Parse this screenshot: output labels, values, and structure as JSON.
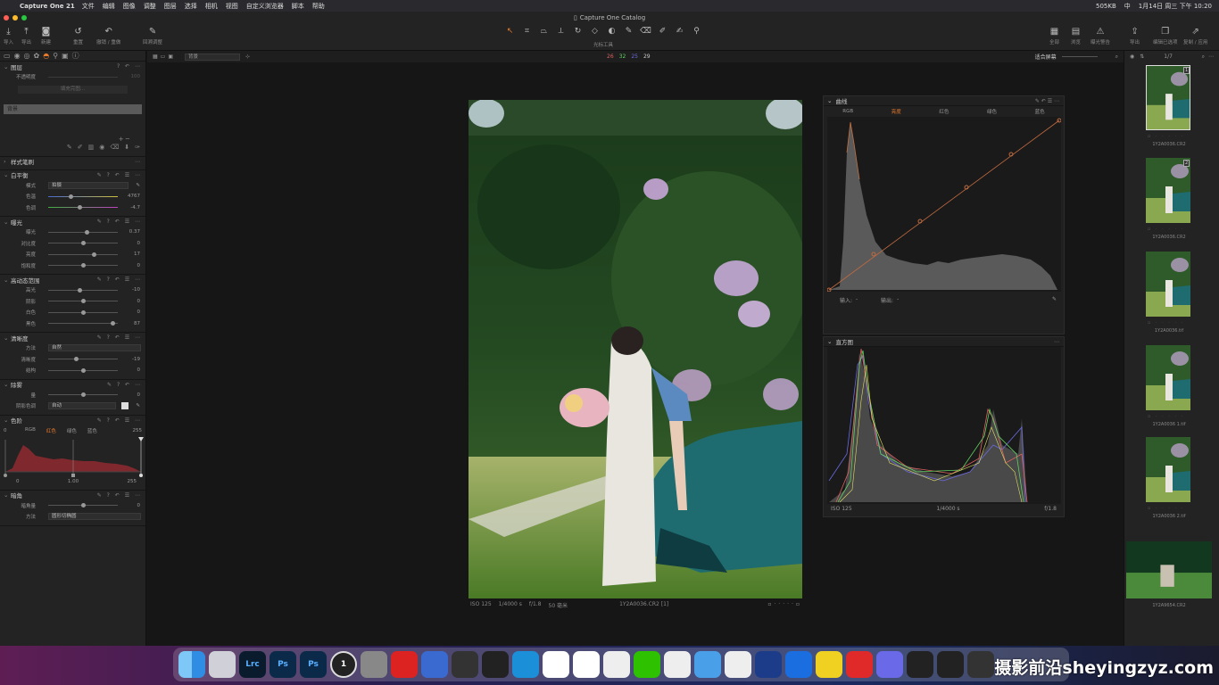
{
  "menubar": {
    "app_name": "Capture One 21",
    "items": [
      "文件",
      "编辑",
      "图像",
      "调整",
      "图层",
      "选择",
      "相机",
      "视图",
      "自定义浏览器",
      "脚本",
      "帮助"
    ],
    "status": [
      "505KB",
      "中",
      "1月14日 周三 下午 10:20"
    ]
  },
  "window": {
    "title": "Capture One Catalog"
  },
  "toolbar": {
    "left_buttons": [
      {
        "label": "导入",
        "icon": "import-icon"
      },
      {
        "label": "导出",
        "icon": "export-icon"
      },
      {
        "label": "新建",
        "icon": "camera-icon"
      },
      {
        "label": "重置",
        "icon": "reset-icon"
      },
      {
        "label": "撤销 / 重做",
        "icon": "undo-icon"
      },
      {
        "label": "回溯调整",
        "icon": "brush-icon"
      }
    ],
    "cursor_tools_label": "光标工具",
    "right_buttons": [
      {
        "label": "全部",
        "icon": "grid-icon"
      },
      {
        "label": "浏览",
        "icon": "browser-icon"
      },
      {
        "label": "曝光警告",
        "icon": "warning-icon"
      },
      {
        "label": "导出",
        "icon": "share-icon"
      },
      {
        "label": "编辑已选项",
        "icon": "edit-selected-icon"
      },
      {
        "label": "复制 / 应用",
        "icon": "copy-apply-icon"
      }
    ]
  },
  "viewer": {
    "layer_select": "背景",
    "readout": [
      "26",
      "32",
      "25",
      "29"
    ],
    "fit_label": "适合屏幕",
    "counter": "1/7"
  },
  "left_panel": {
    "layers": {
      "title": "图层",
      "opacity_label": "不透明度",
      "opacity_value": "100",
      "fill_button": "填充完图...",
      "background_layer": "背景"
    },
    "styles_title": "样式笔刷",
    "white_balance": {
      "title": "白平衡",
      "mode_label": "模式",
      "mode_value": "拍摄",
      "rows": [
        {
          "label": "色温",
          "value": "4767",
          "pos": 0.32
        },
        {
          "label": "色调",
          "value": "-4.7",
          "pos": 0.45
        }
      ]
    },
    "exposure": {
      "title": "曝光",
      "rows": [
        {
          "label": "曝光",
          "value": "0.37",
          "pos": 0.55
        },
        {
          "label": "对比度",
          "value": "0",
          "pos": 0.5
        },
        {
          "label": "亮度",
          "value": "17",
          "pos": 0.65
        },
        {
          "label": "饱和度",
          "value": "0",
          "pos": 0.5
        }
      ]
    },
    "hdr": {
      "title": "高动态范围",
      "rows": [
        {
          "label": "高光",
          "value": "-10",
          "pos": 0.45
        },
        {
          "label": "阴影",
          "value": "0",
          "pos": 0.5
        },
        {
          "label": "白色",
          "value": "0",
          "pos": 0.5
        },
        {
          "label": "黑色",
          "value": "87",
          "pos": 0.92
        }
      ]
    },
    "clarity": {
      "title": "清晰度",
      "method_label": "方法",
      "method_value": "自然",
      "rows": [
        {
          "label": "清晰度",
          "value": "-19",
          "pos": 0.4
        },
        {
          "label": "结构",
          "value": "0",
          "pos": 0.5
        }
      ]
    },
    "dehaze": {
      "title": "除雾",
      "rows": [
        {
          "label": "量",
          "value": "0",
          "pos": 0.5
        }
      ],
      "shadow_label": "阴影色调",
      "shadow_value": "自动"
    },
    "levels": {
      "title": "色阶",
      "channels": [
        "RGB",
        "红色",
        "绿色",
        "蓝色"
      ],
      "active_channel": "红色",
      "min_label": "0",
      "max_label": "255",
      "min_out": "0",
      "mid": "1.00",
      "max_out": "255"
    },
    "vignette": {
      "title": "暗角",
      "rows": [
        {
          "label": "暗角量",
          "value": "0",
          "pos": 0.5
        }
      ],
      "method_label": "方法",
      "method_value": "圆形切椭圆"
    }
  },
  "curve_panel": {
    "title": "曲线",
    "tabs": [
      "RGB",
      "亮度",
      "红色",
      "绿色",
      "蓝色"
    ],
    "active_tab": "亮度",
    "input_label": "输入:",
    "input_value": "-",
    "output_label": "输出:",
    "output_value": "-"
  },
  "histogram_panel": {
    "title": "直方图",
    "iso": "ISO 125",
    "shutter": "1/4000 s",
    "aperture": "f/1.8"
  },
  "photo_meta": {
    "iso": "ISO 125",
    "shutter": "1/4000 s",
    "aperture": "f/1.8",
    "focal": "50 毫米",
    "filename": "1Y2A0036.CR2 [1]"
  },
  "filmstrip": [
    {
      "name": "1Y2A0036.CR2",
      "selected": true,
      "badge": "1"
    },
    {
      "name": "1Y2A0036.CR2",
      "selected": false,
      "badge": "2"
    },
    {
      "name": "1Y2A0036.tif",
      "selected": false,
      "badge": ""
    },
    {
      "name": "1Y2A0036 1.tif",
      "selected": false,
      "badge": ""
    },
    {
      "name": "1Y2A0036 2.tif",
      "selected": false,
      "badge": ""
    },
    {
      "name": "1Y2A9654.CR2",
      "selected": false,
      "badge": ""
    }
  ],
  "dock_apps": [
    {
      "name": "finder",
      "label": "",
      "color": "#2f8de4"
    },
    {
      "name": "launchpad",
      "label": "",
      "color": "#d0d0d8"
    },
    {
      "name": "lightroom-classic",
      "label": "Lrc",
      "color": "#0a1b2e"
    },
    {
      "name": "photoshop",
      "label": "Ps",
      "color": "#0b2a4a"
    },
    {
      "name": "photoshop-2",
      "label": "Ps",
      "color": "#0b2a4a"
    },
    {
      "name": "capture-one",
      "label": "1",
      "color": "#222"
    },
    {
      "name": "app-7",
      "label": "",
      "color": "#888"
    },
    {
      "name": "app-8",
      "label": "",
      "color": "#d22"
    },
    {
      "name": "app-9",
      "label": "",
      "color": "#3a6ad0"
    },
    {
      "name": "davinci",
      "label": "",
      "color": "#333"
    },
    {
      "name": "final-cut",
      "label": "",
      "color": "#222"
    },
    {
      "name": "edge",
      "label": "",
      "color": "#1b8fd8"
    },
    {
      "name": "app-13",
      "label": "",
      "color": "#fff"
    },
    {
      "name": "app-14",
      "label": "",
      "color": "#fff"
    },
    {
      "name": "chrome",
      "label": "",
      "color": "#eee"
    },
    {
      "name": "wechat",
      "label": "",
      "color": "#2dc100"
    },
    {
      "name": "qq",
      "label": "",
      "color": "#eee"
    },
    {
      "name": "app-18",
      "label": "",
      "color": "#49a0e8"
    },
    {
      "name": "app-19",
      "label": "",
      "color": "#eee"
    },
    {
      "name": "app-20",
      "label": "",
      "color": "#1c3c8a"
    },
    {
      "name": "app-21",
      "label": "",
      "color": "#1a6ee0"
    },
    {
      "name": "app-22",
      "label": "",
      "color": "#f0d020"
    },
    {
      "name": "app-23",
      "label": "",
      "color": "#e02a2a"
    },
    {
      "name": "app-24",
      "label": "",
      "color": "#6a6ae8"
    },
    {
      "name": "app-25",
      "label": "",
      "color": "#222"
    },
    {
      "name": "app-26",
      "label": "",
      "color": "#222"
    },
    {
      "name": "app-27",
      "label": "",
      "color": "#333"
    }
  ],
  "watermark": "摄影前沿sheyingzyz.com"
}
